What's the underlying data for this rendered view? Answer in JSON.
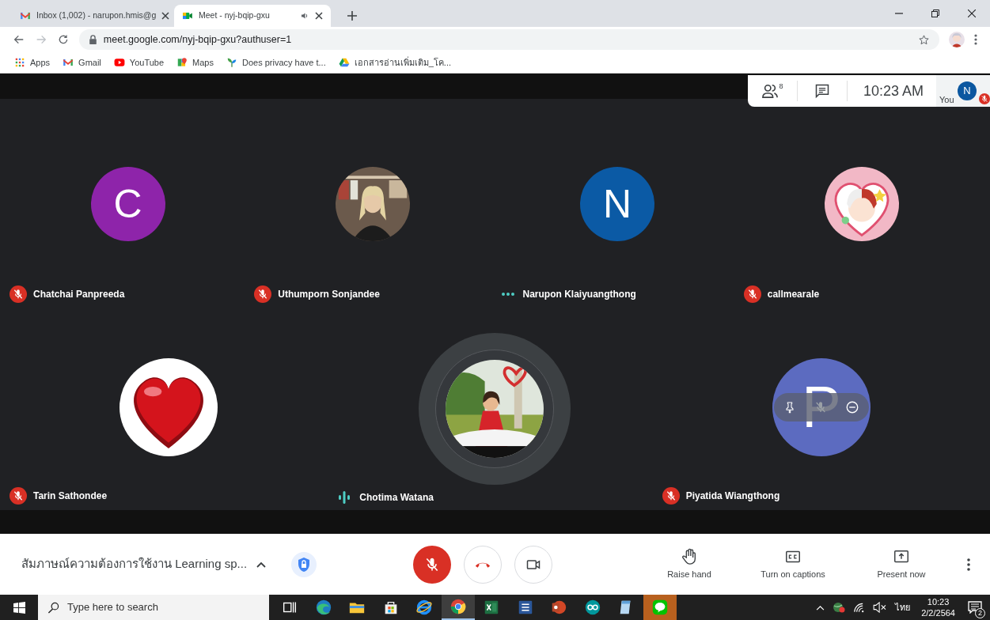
{
  "browser": {
    "tabs": [
      {
        "title": "Inbox (1,002) - narupon.hmis@g",
        "kind": "gmail",
        "selected": false,
        "audio": false
      },
      {
        "title": "Meet - nyj-bqip-gxu",
        "kind": "meet",
        "selected": true,
        "audio": true
      }
    ],
    "url": "meet.google.com/nyj-bqip-gxu?authuser=1",
    "bookmarks": [
      {
        "label": "Apps",
        "kind": "apps"
      },
      {
        "label": "Gmail",
        "kind": "gmail"
      },
      {
        "label": "YouTube",
        "kind": "youtube"
      },
      {
        "label": "Maps",
        "kind": "maps"
      },
      {
        "label": "Does privacy have t...",
        "kind": "leaf"
      },
      {
        "label": "เอกสารอ่านเพิ่มเติม_โค...",
        "kind": "drive"
      }
    ]
  },
  "meeting": {
    "participants_count": "8",
    "time": "10:23 AM",
    "self": {
      "label": "You",
      "initial": "N",
      "muted": true
    }
  },
  "participants": [
    {
      "name": "Chatchai Panpreeda",
      "avatar": {
        "kind": "letter",
        "letter": "C",
        "color": "#8e24aa"
      },
      "muted": true,
      "speaking": false,
      "hovered": false
    },
    {
      "name": "Uthumporn Sonjandee",
      "muted": true,
      "speaking": false,
      "hovered": false
    },
    {
      "name": "Narupon Klaiyuangthong",
      "avatar": {
        "kind": "letter",
        "letter": "N",
        "color": "#0b5aa5"
      },
      "muted": false,
      "speaking": false,
      "hovered": false
    },
    {
      "name": "callmearale",
      "muted": true,
      "speaking": false,
      "hovered": false
    },
    {
      "name": "Tarin Sathondee",
      "muted": true,
      "speaking": false,
      "hovered": false
    },
    {
      "name": "Chotima Watana",
      "muted": false,
      "speaking": true,
      "hovered": false
    },
    {
      "name": "Piyatida Wiangthong",
      "avatar": {
        "kind": "letter",
        "letter": "P",
        "color": "#5c6bc0"
      },
      "muted": true,
      "speaking": false,
      "hovered": true
    }
  ],
  "controls": {
    "meeting_title": "สัมภาษณ์ความต้องการใช้งาน Learning sp...",
    "mic_muted": true,
    "actions": [
      {
        "label": "Raise hand",
        "kind": "hand"
      },
      {
        "label": "Turn on captions",
        "kind": "captions"
      },
      {
        "label": "Present now",
        "kind": "present"
      }
    ]
  },
  "taskbar": {
    "search_placeholder": "Type here to search",
    "apps": [
      {
        "kind": "taskview",
        "active": false,
        "flashing": false
      },
      {
        "kind": "edge",
        "active": false,
        "flashing": false
      },
      {
        "kind": "explorer",
        "active": false,
        "flashing": false
      },
      {
        "kind": "store",
        "active": false,
        "flashing": false
      },
      {
        "kind": "ie",
        "active": false,
        "flashing": false
      },
      {
        "kind": "chrome",
        "active": true,
        "flashing": false
      },
      {
        "kind": "excel",
        "active": false,
        "flashing": false
      },
      {
        "kind": "word",
        "active": false,
        "flashing": false
      },
      {
        "kind": "powerpoint",
        "active": false,
        "flashing": false
      },
      {
        "kind": "arduino",
        "active": false,
        "flashing": false
      },
      {
        "kind": "notepad",
        "active": false,
        "flashing": false
      },
      {
        "kind": "line",
        "active": false,
        "flashing": true
      }
    ],
    "language": "ไทย",
    "time": "10:23",
    "date": "2/2/2564",
    "notifications": "2"
  }
}
